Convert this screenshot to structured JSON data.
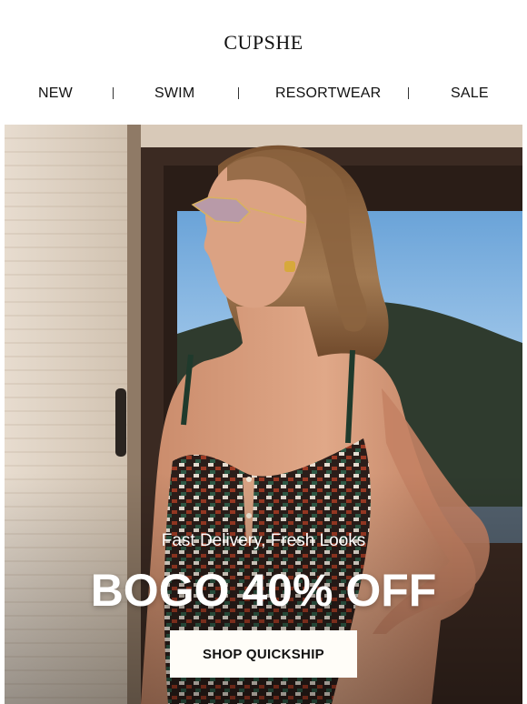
{
  "brand": {
    "logo_text": "CUPSHE"
  },
  "nav": {
    "items": [
      {
        "label": "NEW"
      },
      {
        "label": "SWIM"
      },
      {
        "label": "RESORTWEAR"
      },
      {
        "label": "SALE"
      }
    ]
  },
  "hero": {
    "image_icon": "model-in-patterned-swimsuit-photo",
    "subheadline": "Fast Delivery, Fresh Looks",
    "headline": "BOGO 40% OFF",
    "cta_label": "SHOP QUICKSHIP"
  },
  "colors": {
    "background": "#ffffff",
    "text": "#111111",
    "cta_background": "#fffdf8",
    "hero_text": "#ffffff"
  }
}
